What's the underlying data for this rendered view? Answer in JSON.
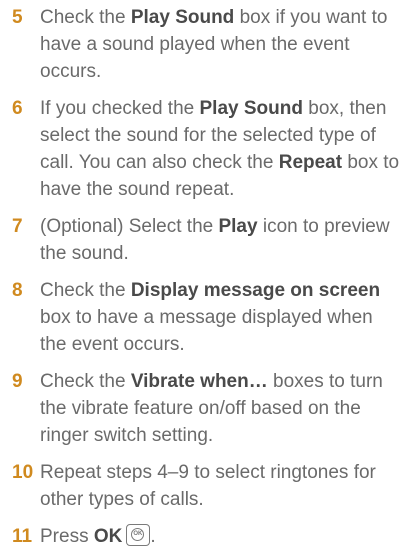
{
  "steps": [
    {
      "number": "5",
      "pre": "Check the ",
      "bold": "Play Sound",
      "post": " box if you want to have a sound played when the event occurs."
    },
    {
      "number": "6",
      "pre": "If you checked the ",
      "bold": "Play Sound",
      "post": " box, then select the sound for the selected type of call. You can also check the ",
      "bold2": "Repeat",
      "post2": " box to have the sound repeat."
    },
    {
      "number": "7",
      "pre": "(Optional)  Select the ",
      "bold": "Play",
      "post": " icon to preview the sound."
    },
    {
      "number": "8",
      "pre": "Check the ",
      "bold": "Display message on screen",
      "post": " box to have a message displayed when the event occurs."
    },
    {
      "number": "9",
      "pre": "Check the ",
      "bold": "Vibrate when…",
      "post": " boxes to turn the vibrate feature on/off based on the ringer switch setting."
    },
    {
      "number": "10",
      "pre": "Repeat steps 4–9 to select ringtones for other types of calls."
    },
    {
      "number": "11",
      "pre": "Press ",
      "bold": "OK",
      "key_glyph": "ok-key-icon",
      "post": "."
    }
  ],
  "colors": {
    "step_number": "#d08a1f",
    "body_text": "#6a6a6a",
    "bold_text": "#4a4a4a"
  }
}
